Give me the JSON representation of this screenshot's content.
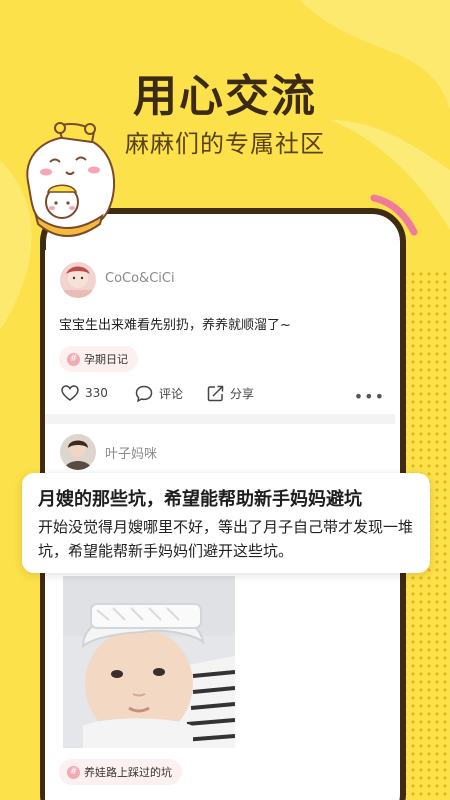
{
  "hero": {
    "title": "用心交流",
    "subtitle": "麻麻们的专属社区"
  },
  "colors": {
    "background": "#FCE14A",
    "phone_frame": "#3f2a12",
    "tag_bg": "#fdf0f1",
    "accent_pink": "#f5a9b3"
  },
  "post1": {
    "username": "CoCo&CiCi",
    "text": "宝宝生出来难看先别扔，养养就顺溜了~",
    "tag": "孕期日记",
    "likes": "330",
    "comment_label": "评论",
    "share_label": "分享"
  },
  "post2": {
    "username": "叶子妈咪",
    "title": "月嫂的那些坑，希望能帮助新手妈妈避坑",
    "body": "开始没觉得月嫂哪里不好，等出了月子自己带才发现一堆坑，希望能帮新手妈妈们避开这些坑。",
    "tag": "养娃路上踩过的坑"
  },
  "icons": {
    "like": "heart-icon",
    "comment": "comment-icon",
    "share": "share-icon",
    "more": "more-icon",
    "tag": "hash-icon"
  }
}
